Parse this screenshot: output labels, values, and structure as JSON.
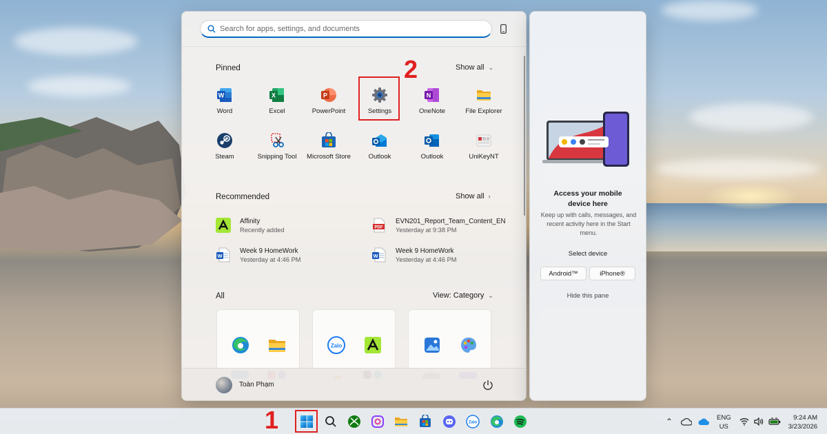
{
  "search": {
    "placeholder": "Search for apps, settings, and documents"
  },
  "pinned": {
    "title": "Pinned",
    "show_all": "Show all",
    "apps": [
      {
        "label": "Word",
        "icon": "word-icon"
      },
      {
        "label": "Excel",
        "icon": "excel-icon"
      },
      {
        "label": "PowerPoint",
        "icon": "powerpoint-icon"
      },
      {
        "label": "Settings",
        "icon": "gear-icon"
      },
      {
        "label": "OneNote",
        "icon": "onenote-icon"
      },
      {
        "label": "File Explorer",
        "icon": "folder-icon"
      },
      {
        "label": "Steam",
        "icon": "steam-icon"
      },
      {
        "label": "Snipping Tool",
        "icon": "scissors-icon"
      },
      {
        "label": "Microsoft Store",
        "icon": "store-icon"
      },
      {
        "label": "Outlook",
        "icon": "outlook-icon"
      },
      {
        "label": "Outlook",
        "icon": "outlook-icon"
      },
      {
        "label": "UniKeyNT",
        "icon": "unikey-icon"
      }
    ]
  },
  "recommended": {
    "title": "Recommended",
    "show_all": "Show all",
    "items": [
      {
        "name": "Affinity",
        "sub": "Recently added",
        "icon": "affinity-icon"
      },
      {
        "name": "EVN201_Report_Team_Content_EN",
        "sub": "Yesterday at 9:38 PM",
        "icon": "pdf-icon"
      },
      {
        "name": "Week 9 HomeWork",
        "sub": "Yesterday at 4:46 PM",
        "icon": "word-doc-icon"
      },
      {
        "name": "Week 9 HomeWork",
        "sub": "Yesterday at 4:46 PM",
        "icon": "word-doc-icon"
      }
    ]
  },
  "all": {
    "title": "All",
    "view": "View: Category"
  },
  "user": {
    "name": "Toàn Phạm"
  },
  "annotations": {
    "step1": "1",
    "step2": "2"
  },
  "phone_pane": {
    "title": "Access your mobile device here",
    "desc": "Keep up with calls, messages, and recent activity here in the Start menu.",
    "select": "Select device",
    "android": "Android™",
    "iphone": "iPhone®",
    "hide": "Hide this pane"
  },
  "tray": {
    "lang1": "ENG",
    "lang2": "US",
    "time": "9:24 AM",
    "date": "3/23/2026"
  },
  "colors": {
    "accent": "#0067c0",
    "highlight": "#e02020"
  }
}
